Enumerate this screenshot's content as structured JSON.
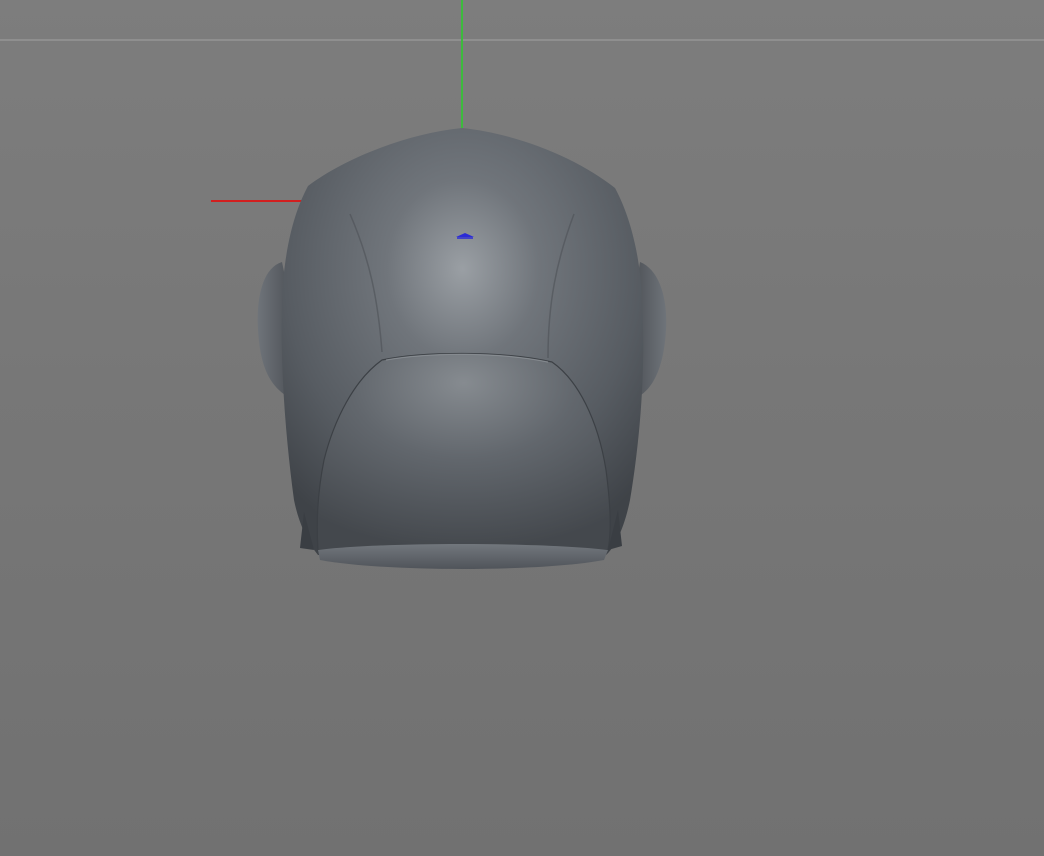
{
  "viewport": {
    "background_top": "#7d7d7d",
    "background_bottom": "#717171",
    "horizon_line_color": "#8f8f8f"
  },
  "axes": {
    "x_axis_color": "#d21f1f",
    "y_axis_color": "#3dbb3d",
    "pivot_color": "#2b2bd6"
  },
  "model": {
    "name": "helmet-mesh",
    "shading": "matte-grey",
    "base_color": "#5d6268",
    "highlight_color": "#8c9196",
    "shadow_color": "#3e4247"
  }
}
